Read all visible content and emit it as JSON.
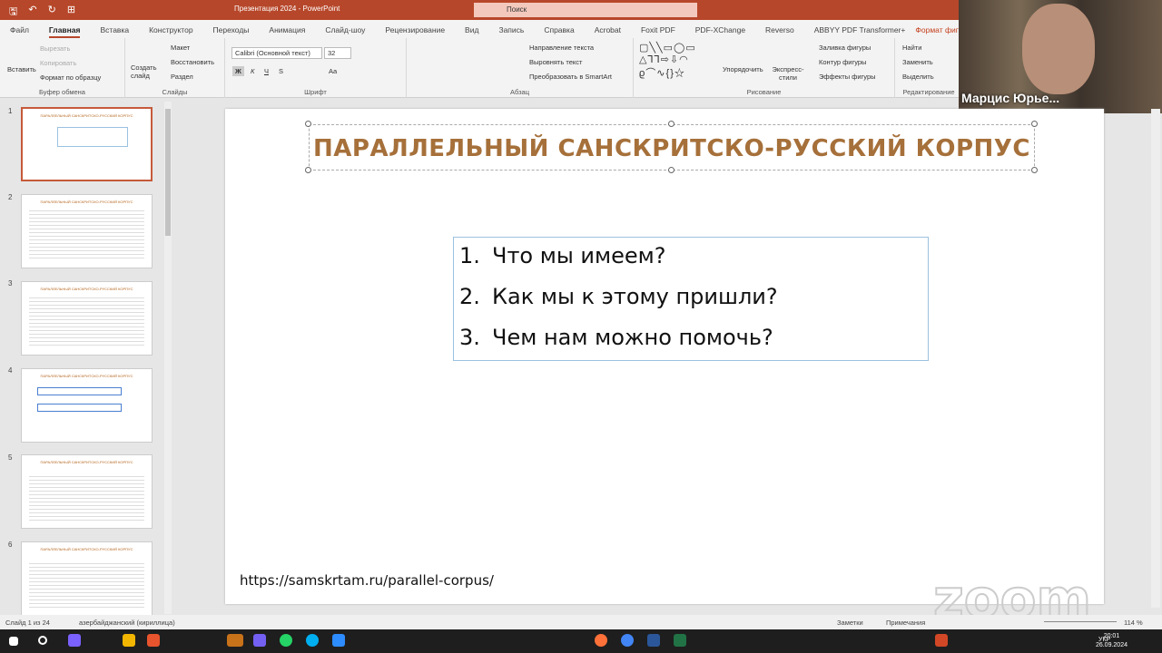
{
  "app": {
    "title": "Презентация 2024  -  PowerPoint",
    "search_placeholder": "Поиск"
  },
  "tabs": [
    "Файл",
    "Главная",
    "Вставка",
    "Конструктор",
    "Переходы",
    "Анимация",
    "Слайд-шоу",
    "Рецензирование",
    "Вид",
    "Запись",
    "Справка",
    "Acrobat",
    "Foxit PDF",
    "PDF-XChange",
    "Reverso",
    "ABBYY PDF Transformer+",
    "Формат фигуры"
  ],
  "ribbon": {
    "clipboard": {
      "paste": "Вставить",
      "cut": "Вырезать",
      "copy": "Копировать",
      "format_painter": "Формат по образцу",
      "label": "Буфер обмена"
    },
    "slides": {
      "new_slide": "Создать слайд",
      "layout": "Макет",
      "reset": "Восстановить",
      "section": "Раздел",
      "label": "Слайды"
    },
    "font": {
      "name": "Calibri (Основной текст)",
      "size": "32",
      "label": "Шрифт",
      "bold": "Ж",
      "italic": "К",
      "underline": "Ч",
      "strike": "S",
      "case": "Aa"
    },
    "paragraph": {
      "text_direction": "Направление текста",
      "align_text": "Выровнять текст",
      "smartart": "Преобразовать в SmartArt",
      "label": "Абзац"
    },
    "drawing": {
      "arrange": "Упорядочить",
      "quick_styles": "Экспресс-стили",
      "fill": "Заливка фигуры",
      "outline": "Контур фигуры",
      "effects": "Эффекты фигуры",
      "label": "Рисование"
    },
    "editing": {
      "find": "Найти",
      "replace": "Заменить",
      "select": "Выделить",
      "label": "Редактирование"
    }
  },
  "webcam": {
    "name": "Марцис Юрье..."
  },
  "thumbnails": [
    {
      "num": "1",
      "title": "ПАРАЛЛЕЛЬНЫЙ САНСКРИТСКО-РУССКИЙ КОРПУС"
    },
    {
      "num": "2",
      "title": "ПАРАЛЛЕЛЬНЫЙ САНСКРИТСКО-РУССКИЙ КОРПУС"
    },
    {
      "num": "3",
      "title": "ПАРАЛЛЕЛЬНЫЙ САНСКРИТСКО-РУССКИЙ КОРПУС"
    },
    {
      "num": "4",
      "title": "ПАРАЛЛЕЛЬНЫЙ САНСКРИТСКО-РУССКИЙ КОРПУС"
    },
    {
      "num": "5",
      "title": "ПАРАЛЛЕЛЬНЫЙ САНСКРИТСКО-РУССКИЙ КОРПУС"
    },
    {
      "num": "6",
      "title": "ПАРАЛЛЕЛЬНЫЙ САНСКРИТСКО-РУССКИЙ КОРПУС"
    }
  ],
  "slide": {
    "title": "ПАРАЛЛЕЛЬНЫЙ САНСКРИТСКО-РУССКИЙ КОРПУС",
    "items": [
      {
        "n": "1.",
        "text": "Что мы имеем?"
      },
      {
        "n": "2.",
        "text": "Как мы к этому пришли?"
      },
      {
        "n": "3.",
        "text": "Чем нам можно помочь?"
      }
    ],
    "url": "https://samskrtam.ru/parallel-corpus/",
    "watermark": "zoom"
  },
  "status": {
    "slide": "Слайд 1 из 24",
    "language": "азербайджанский (кириллица)",
    "notes": "Заметки",
    "comments": "Примечания",
    "zoom": "114 %"
  },
  "taskbar": {
    "lang": "УКР",
    "time": "20:01",
    "date": "26.09.2024"
  },
  "colors": {
    "accent": "#b7472a",
    "title_text": "#a6703a"
  }
}
